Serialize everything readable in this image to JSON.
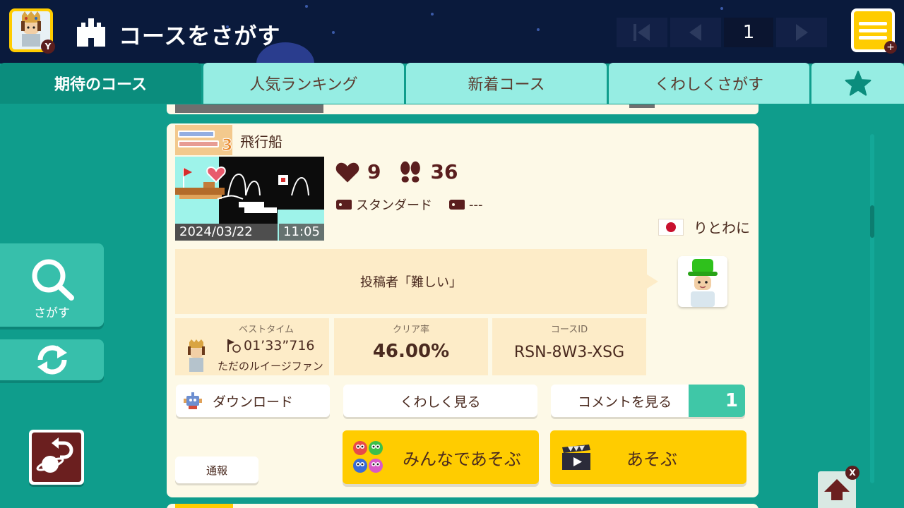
{
  "header": {
    "title": "コースをさがす",
    "avatar_badge": "Y",
    "menu_badge": "+",
    "page_number": "1"
  },
  "tabs": [
    {
      "label": "期待のコース",
      "active": true
    },
    {
      "label": "人気ランキング",
      "active": false
    },
    {
      "label": "新着コース",
      "active": false
    },
    {
      "label": "くわしくさがす",
      "active": false
    },
    {
      "label": "",
      "icon": "star-icon",
      "active": false
    }
  ],
  "course": {
    "style": "SUPER MARIO BROS. 3",
    "title": "飛行船",
    "upload_date": "2024/03/22",
    "upload_time": "11:05",
    "likes": "9",
    "plays": "36",
    "tag1": "スタンダード",
    "tag2": "---",
    "creator_name": "りとわに",
    "description": "投稿者「難しい」",
    "best_time_label": "ベストタイム",
    "best_time": "01’33”716",
    "best_time_player": "ただのルイージファン",
    "clear_rate_label": "クリア率",
    "clear_rate": "46.00%",
    "course_id_label": "コースID",
    "course_id": "RSN-8W3-XSG"
  },
  "actions": {
    "download": "ダウンロード",
    "details": "くわしく見る",
    "comments": "コメントを見る",
    "comment_count": "1",
    "report": "通報",
    "multiplayer": "みんなであそぶ",
    "play": "あそぶ"
  },
  "sidebar": {
    "search_label": "さがす"
  },
  "badges": {
    "up_x": "X"
  },
  "colors": {
    "header_bg": "#0a1a3c",
    "tab_inactive": "#96ede3",
    "tab_active": "#0b8d7d",
    "background": "#0f9d8c",
    "yellow": "#ffcc00",
    "dark_red": "#5a1e1e"
  }
}
